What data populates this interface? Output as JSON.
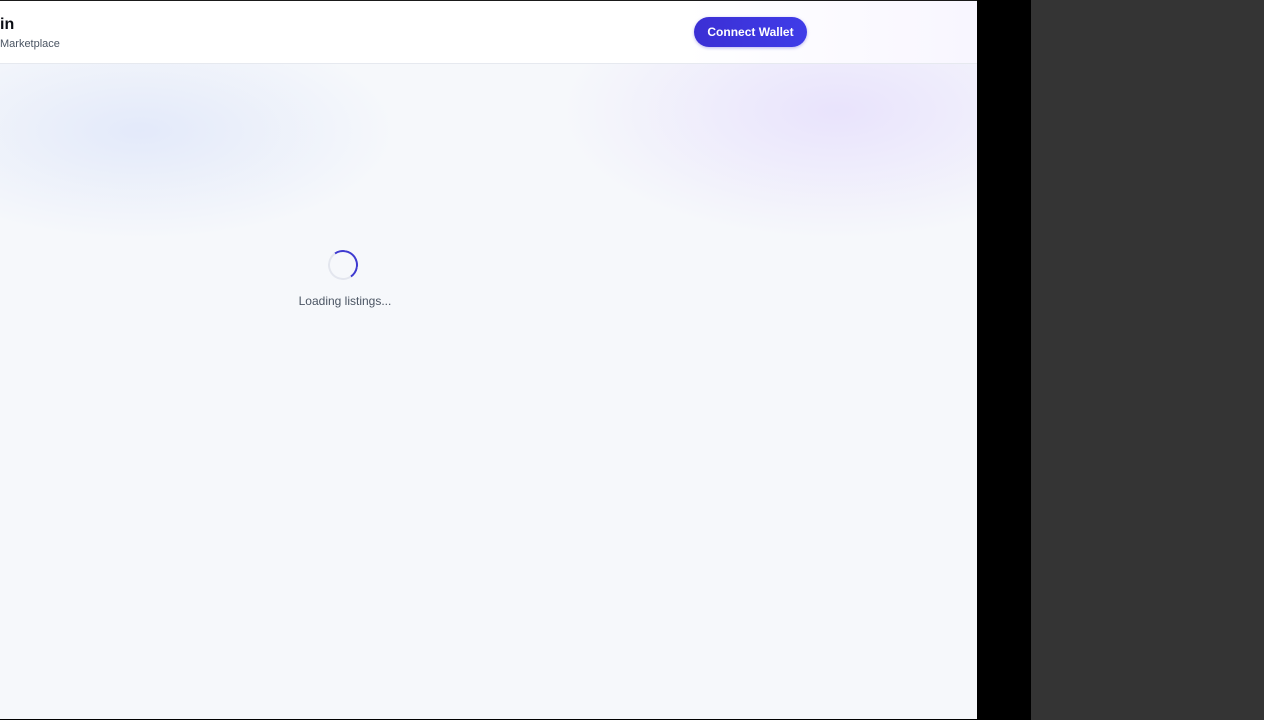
{
  "header": {
    "brand_title": "in",
    "brand_subtitle": "Marketplace",
    "connect_wallet_label": "Connect Wallet"
  },
  "main": {
    "loading_text": "Loading listings..."
  },
  "icons": {
    "spinner": "loading-spinner-icon"
  },
  "colors": {
    "accent": "#3b2fd4",
    "page_background": "#f6f8fb",
    "side_panel": "#343434"
  }
}
